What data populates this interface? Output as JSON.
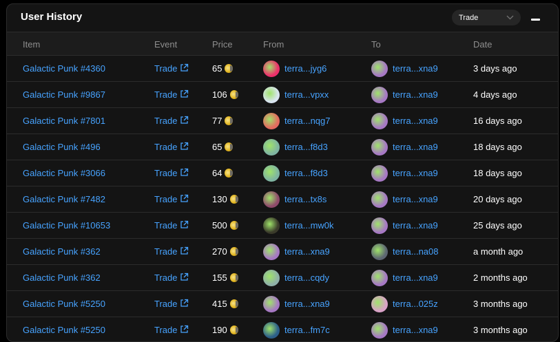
{
  "panel": {
    "title": "User History",
    "filter_value": "Trade"
  },
  "columns": {
    "item": "Item",
    "event": "Event",
    "price": "Price",
    "from": "From",
    "to": "To",
    "date": "Date"
  },
  "icons": {
    "coin": "luna-coin-icon",
    "external": "external-link-icon",
    "chevron": "chevron-down-icon",
    "minimize": "minimize-icon"
  },
  "rows": [
    {
      "item": "Galactic Punk #4360",
      "event": "Trade",
      "price": "65",
      "from": "terra...jyg6",
      "to": "terra...xna9",
      "date": "3 days ago",
      "from_avatar": "#ec2f6a",
      "to_avatar": "#a678c4"
    },
    {
      "item": "Galactic Punk #9867",
      "event": "Trade",
      "price": "106",
      "from": "terra...vpxx",
      "to": "terra...xna9",
      "date": "4 days ago",
      "from_avatar": "#d9e4f0",
      "to_avatar": "#a678c4"
    },
    {
      "item": "Galactic Punk #7801",
      "event": "Trade",
      "price": "77",
      "from": "terra...nqg7",
      "to": "terra...xna9",
      "date": "16 days ago",
      "from_avatar": "#e36a5f",
      "to_avatar": "#a678c4"
    },
    {
      "item": "Galactic Punk #496",
      "event": "Trade",
      "price": "65",
      "from": "terra...f8d3",
      "to": "terra...xna9",
      "date": "18 days ago",
      "from_avatar": "#7fb4a1",
      "to_avatar": "#a678c4"
    },
    {
      "item": "Galactic Punk #3066",
      "event": "Trade",
      "price": "64",
      "from": "terra...f8d3",
      "to": "terra...xna9",
      "date": "18 days ago",
      "from_avatar": "#7fb4a1",
      "to_avatar": "#a678c4"
    },
    {
      "item": "Galactic Punk #7482",
      "event": "Trade",
      "price": "130",
      "from": "terra...tx8s",
      "to": "terra...xna9",
      "date": "20 days ago",
      "from_avatar": "#8e4a6a",
      "to_avatar": "#a678c4"
    },
    {
      "item": "Galactic Punk #10653",
      "event": "Trade",
      "price": "500",
      "from": "terra...mw0k",
      "to": "terra...xna9",
      "date": "25 days ago",
      "from_avatar": "#3a3a2a",
      "to_avatar": "#a678c4"
    },
    {
      "item": "Galactic Punk #362",
      "event": "Trade",
      "price": "270",
      "from": "terra...xna9",
      "to": "terra...na08",
      "date": "a month ago",
      "from_avatar": "#a678c4",
      "to_avatar": "#5d6672"
    },
    {
      "item": "Galactic Punk #362",
      "event": "Trade",
      "price": "155",
      "from": "terra...cqdy",
      "to": "terra...xna9",
      "date": "2 months ago",
      "from_avatar": "#8fb0a8",
      "to_avatar": "#a678c4"
    },
    {
      "item": "Galactic Punk #5250",
      "event": "Trade",
      "price": "415",
      "from": "terra...xna9",
      "to": "terra...025z",
      "date": "3 months ago",
      "from_avatar": "#a678c4",
      "to_avatar": "#d9a2c7"
    },
    {
      "item": "Galactic Punk #5250",
      "event": "Trade",
      "price": "190",
      "from": "terra...fm7c",
      "to": "terra...xna9",
      "date": "3 months ago",
      "from_avatar": "#2c5e88",
      "to_avatar": "#a678c4"
    }
  ]
}
